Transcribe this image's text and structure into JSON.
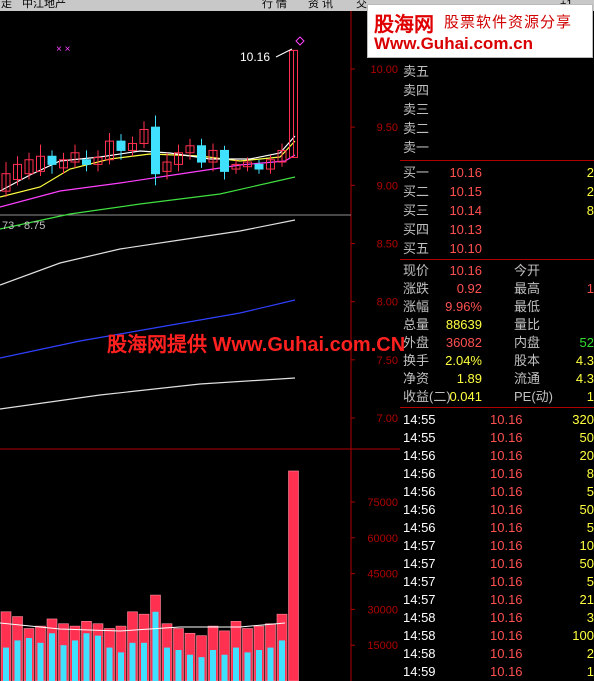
{
  "topbar": {
    "col1": "走",
    "col2": "中江地产",
    "col3": "行 情",
    "col4": "资 讯",
    "col5": "交 ",
    "col6": "+1"
  },
  "logo": {
    "brand": "股海网",
    "tagline": "股票软件资源分享",
    "url": "Www.Guhai.com.cn"
  },
  "watermark": "股海网提供 Www.Guhai.com.CN",
  "kline": {
    "high_label": "10.16",
    "marker": "×  ×",
    "ma_label": "73 - 8.75",
    "price_axis": [
      "10.00",
      "9.50",
      "9.00",
      "8.50",
      "8.00",
      "7.50",
      "7.00"
    ],
    "price_values": [
      10.0,
      9.5,
      9.0,
      8.5,
      8.0,
      7.5,
      7.0
    ],
    "candles": [
      {
        "o": 8.95,
        "c": 9.1,
        "h": 9.2,
        "l": 8.9
      },
      {
        "o": 9.05,
        "c": 9.18,
        "h": 9.25,
        "l": 9.0
      },
      {
        "o": 9.1,
        "c": 9.22,
        "h": 9.28,
        "l": 9.05
      },
      {
        "o": 9.12,
        "c": 9.25,
        "h": 9.35,
        "l": 9.08
      },
      {
        "o": 9.25,
        "c": 9.18,
        "h": 9.3,
        "l": 9.1
      },
      {
        "o": 9.15,
        "c": 9.22,
        "h": 9.28,
        "l": 9.1
      },
      {
        "o": 9.2,
        "c": 9.28,
        "h": 9.35,
        "l": 9.15
      },
      {
        "o": 9.22,
        "c": 9.18,
        "h": 9.3,
        "l": 9.12
      },
      {
        "o": 9.18,
        "c": 9.24,
        "h": 9.3,
        "l": 9.12
      },
      {
        "o": 9.22,
        "c": 9.38,
        "h": 9.45,
        "l": 9.18
      },
      {
        "o": 9.38,
        "c": 9.3,
        "h": 9.44,
        "l": 9.22
      },
      {
        "o": 9.3,
        "c": 9.36,
        "h": 9.42,
        "l": 9.25
      },
      {
        "o": 9.36,
        "c": 9.48,
        "h": 9.55,
        "l": 9.32
      },
      {
        "o": 9.5,
        "c": 9.1,
        "h": 9.6,
        "l": 9.0
      },
      {
        "o": 9.12,
        "c": 9.2,
        "h": 9.28,
        "l": 9.05
      },
      {
        "o": 9.18,
        "c": 9.28,
        "h": 9.35,
        "l": 9.12
      },
      {
        "o": 9.28,
        "c": 9.34,
        "h": 9.4,
        "l": 9.22
      },
      {
        "o": 9.34,
        "c": 9.2,
        "h": 9.4,
        "l": 9.15
      },
      {
        "o": 9.2,
        "c": 9.3,
        "h": 9.36,
        "l": 9.12
      },
      {
        "o": 9.3,
        "c": 9.12,
        "h": 9.34,
        "l": 9.05
      },
      {
        "o": 9.14,
        "c": 9.18,
        "h": 9.22,
        "l": 9.1
      },
      {
        "o": 9.16,
        "c": 9.2,
        "h": 9.24,
        "l": 9.12
      },
      {
        "o": 9.18,
        "c": 9.14,
        "h": 9.22,
        "l": 9.1
      },
      {
        "o": 9.14,
        "c": 9.22,
        "h": 9.26,
        "l": 9.1
      },
      {
        "o": 9.2,
        "c": 9.3,
        "h": 9.36,
        "l": 9.16
      },
      {
        "o": 9.24,
        "c": 10.16,
        "h": 10.16,
        "l": 9.24
      }
    ],
    "volume_axis": [
      "75000",
      "60000",
      "45000",
      "30000",
      "15000"
    ],
    "volume_ticks": [
      75000,
      60000,
      45000,
      30000,
      15000
    ],
    "volumes": [
      29000,
      27000,
      22000,
      23000,
      26000,
      24000,
      23000,
      25000,
      24000,
      22000,
      23000,
      29000,
      28000,
      36000,
      24000,
      22000,
      20000,
      19000,
      23000,
      21000,
      25000,
      22000,
      23000,
      24000,
      28000,
      88000
    ],
    "volumes_down": [
      14000,
      17000,
      18000,
      16000,
      20000,
      15000,
      17000,
      20000,
      19000,
      14000,
      12000,
      16000,
      16000,
      29000,
      14000,
      13000,
      11000,
      10000,
      13000,
      11000,
      14000,
      12000,
      13000,
      14000,
      17000,
      0
    ]
  },
  "quote": {
    "sell": [
      {
        "label": "卖五",
        "price": "",
        "vol": ""
      },
      {
        "label": "卖四",
        "price": "",
        "vol": ""
      },
      {
        "label": "卖三",
        "price": "",
        "vol": ""
      },
      {
        "label": "卖二",
        "price": "",
        "vol": ""
      },
      {
        "label": "卖一",
        "price": "",
        "vol": ""
      }
    ],
    "buy": [
      {
        "label": "买一",
        "price": "10.16",
        "vol": "2"
      },
      {
        "label": "买二",
        "price": "10.15",
        "vol": "2"
      },
      {
        "label": "买三",
        "price": "10.14",
        "vol": "8"
      },
      {
        "label": "买四",
        "price": "10.13",
        "vol": ""
      },
      {
        "label": "买五",
        "price": "10.10",
        "vol": ""
      }
    ],
    "stats": [
      {
        "l1": "现价",
        "v1": "10.16",
        "c1": "red",
        "l2": "今开",
        "v2": "",
        "c2": "red"
      },
      {
        "l1": "涨跌",
        "v1": "0.92",
        "c1": "red",
        "l2": "最高",
        "v2": "1",
        "c2": "red"
      },
      {
        "l1": "涨幅",
        "v1": "9.96%",
        "c1": "red",
        "l2": "最低",
        "v2": "",
        "c2": "red"
      },
      {
        "l1": "总量",
        "v1": "88639",
        "c1": "yel",
        "l2": "量比",
        "v2": "",
        "c2": "yel"
      },
      {
        "l1": "外盘",
        "v1": "36082",
        "c1": "red",
        "l2": "内盘",
        "v2": "52",
        "c2": "grn"
      },
      {
        "l1": "换手",
        "v1": "2.04%",
        "c1": "yel",
        "l2": "股本",
        "v2": "4.3",
        "c2": "yel"
      },
      {
        "l1": "净资",
        "v1": "1.89",
        "c1": "yel",
        "l2": "流通",
        "v2": "4.3",
        "c2": "yel"
      },
      {
        "l1": "收益(二)",
        "v1": "0.041",
        "c1": "yel",
        "l2": "PE(动)",
        "v2": "1",
        "c2": "yel"
      }
    ],
    "ticks": [
      {
        "time": "14:55",
        "price": "10.16",
        "vol": "320"
      },
      {
        "time": "14:55",
        "price": "10.16",
        "vol": "50"
      },
      {
        "time": "14:56",
        "price": "10.16",
        "vol": "20"
      },
      {
        "time": "14:56",
        "price": "10.16",
        "vol": "8"
      },
      {
        "time": "14:56",
        "price": "10.16",
        "vol": "5"
      },
      {
        "time": "14:56",
        "price": "10.16",
        "vol": "50"
      },
      {
        "time": "14:56",
        "price": "10.16",
        "vol": "5"
      },
      {
        "time": "14:57",
        "price": "10.16",
        "vol": "10"
      },
      {
        "time": "14:57",
        "price": "10.16",
        "vol": "50"
      },
      {
        "time": "14:57",
        "price": "10.16",
        "vol": "5"
      },
      {
        "time": "14:57",
        "price": "10.16",
        "vol": "21"
      },
      {
        "time": "14:58",
        "price": "10.16",
        "vol": "3"
      },
      {
        "time": "14:58",
        "price": "10.16",
        "vol": "100"
      },
      {
        "time": "14:58",
        "price": "10.16",
        "vol": "2"
      },
      {
        "time": "14:59",
        "price": "10.16",
        "vol": "1"
      }
    ]
  },
  "colors": {
    "up": "#ff3050",
    "down": "#40e0ff",
    "axis": "#b00000",
    "ma5": "#ffffff",
    "ma10": "#ffff40",
    "ma20": "#ff40ff",
    "ma30": "#40e040",
    "ma60": "#e0e0e0",
    "ma120": "#3040ff"
  }
}
